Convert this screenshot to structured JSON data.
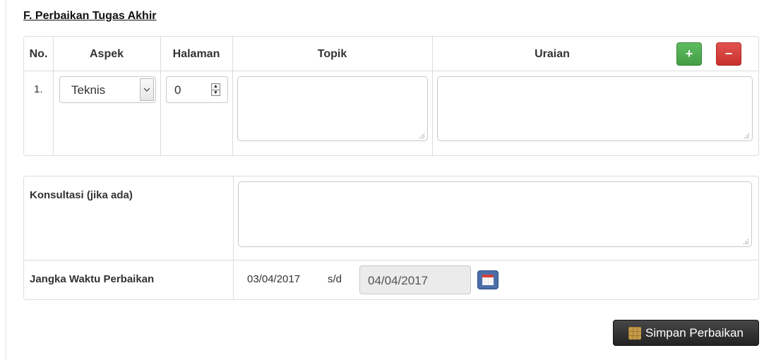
{
  "section": {
    "title": "F. Perbaikan Tugas Akhir"
  },
  "table": {
    "headers": {
      "no": "No.",
      "aspek": "Aspek",
      "halaman": "Halaman",
      "topik": "Topik",
      "uraian": "Uraian"
    },
    "add_label": "+",
    "remove_label": "−",
    "rows": [
      {
        "no": "1.",
        "aspek": "Teknis",
        "halaman": "0",
        "topik": "",
        "uraian": ""
      }
    ]
  },
  "consultation": {
    "label": "Konsultasi (jika ada)",
    "value": ""
  },
  "period": {
    "label": "Jangka Waktu Perbaikan",
    "start": "03/04/2017",
    "separator": "s/d",
    "end": "04/04/2017"
  },
  "save_button": {
    "label": "Simpan Perbaikan"
  },
  "icons": [
    "chevron-down-icon",
    "spinner-icon",
    "calendar-icon",
    "save-icon",
    "resize-grip-icon"
  ],
  "colors": {
    "add": "#449d44",
    "remove": "#c9302c",
    "calendar": "#4a6ea9",
    "save": "#2b2b2b"
  }
}
